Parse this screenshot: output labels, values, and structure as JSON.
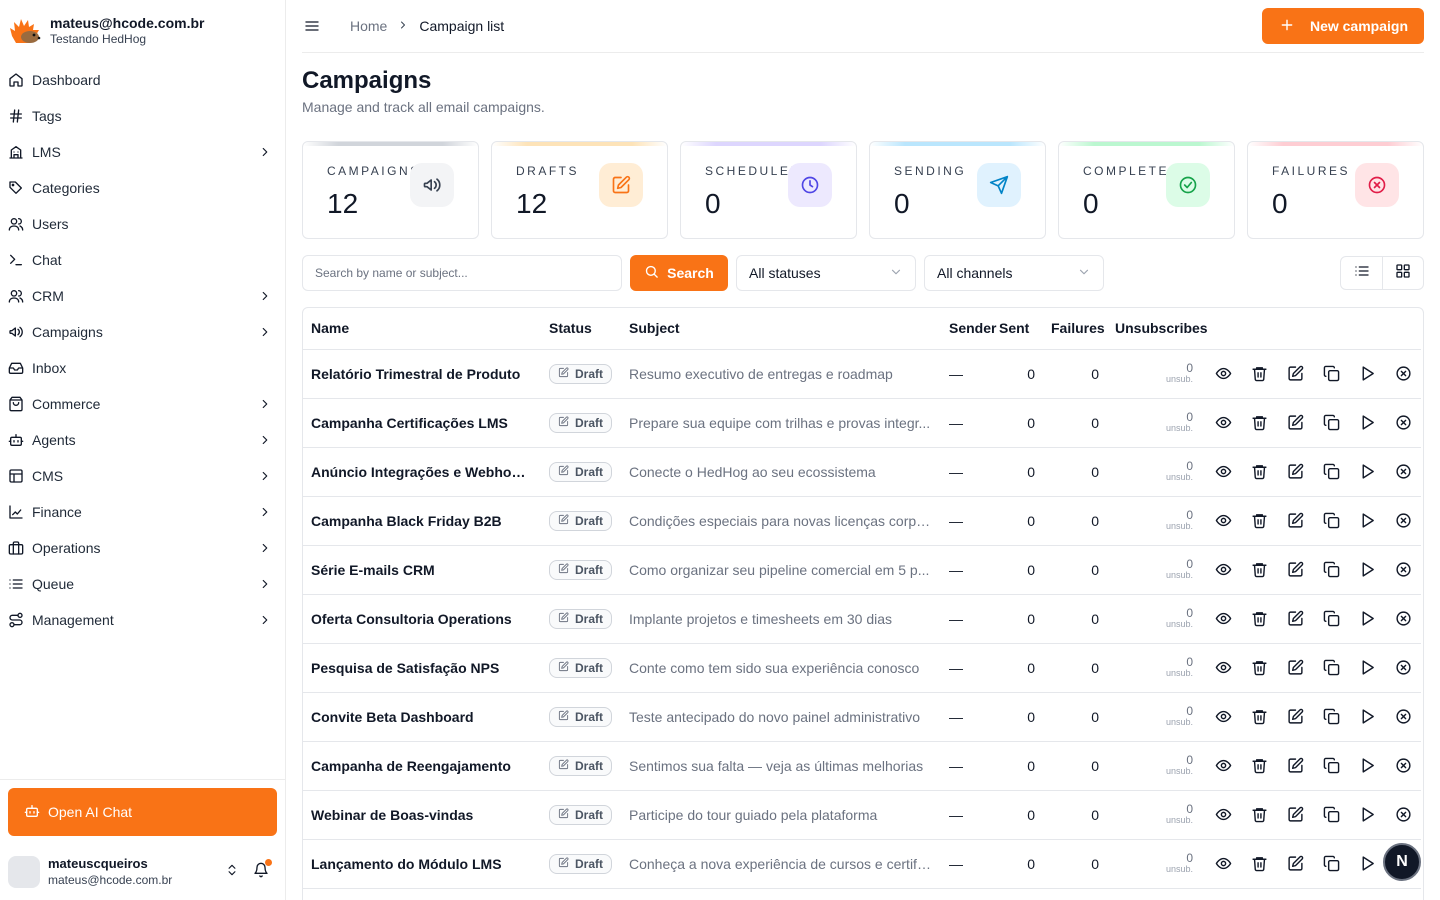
{
  "brand": {
    "email": "mateus@hcode.com.br",
    "org": "Testando HedHog"
  },
  "nav": [
    {
      "label": "Dashboard",
      "icon": "home-icon",
      "chevron": false
    },
    {
      "label": "Tags",
      "icon": "hash-icon",
      "chevron": false
    },
    {
      "label": "LMS",
      "icon": "school-icon",
      "chevron": true
    },
    {
      "label": "Categories",
      "icon": "tag-icon",
      "chevron": false
    },
    {
      "label": "Users",
      "icon": "users-icon",
      "chevron": false
    },
    {
      "label": "Chat",
      "icon": "terminal-icon",
      "chevron": false
    },
    {
      "label": "CRM",
      "icon": "users-icon",
      "chevron": true
    },
    {
      "label": "Campaigns",
      "icon": "megaphone-icon",
      "chevron": true
    },
    {
      "label": "Inbox",
      "icon": "inbox-icon",
      "chevron": false
    },
    {
      "label": "Commerce",
      "icon": "shopping-bag-icon",
      "chevron": true
    },
    {
      "label": "Agents",
      "icon": "bot-icon",
      "chevron": true
    },
    {
      "label": "CMS",
      "icon": "layout-icon",
      "chevron": true
    },
    {
      "label": "Finance",
      "icon": "chart-icon",
      "chevron": true
    },
    {
      "label": "Operations",
      "icon": "briefcase-icon",
      "chevron": true
    },
    {
      "label": "Queue",
      "icon": "list-icon",
      "chevron": true
    },
    {
      "label": "Management",
      "icon": "route-icon",
      "chevron": true
    }
  ],
  "ai_button": "Open AI Chat",
  "user": {
    "name": "mateuscqueiros",
    "email": "mateus@hcode.com.br"
  },
  "breadcrumb": {
    "home": "Home",
    "current": "Campaign list"
  },
  "new_campaign": "New campaign",
  "page": {
    "title": "Campaigns",
    "subtitle": "Manage and track all email campaigns."
  },
  "stats": [
    {
      "label": "CAMPAIGNS",
      "value": "12",
      "icon": "megaphone-icon",
      "color": "#374151",
      "bg": "#f3f4f6",
      "bar": "#d1d5db"
    },
    {
      "label": "DRAFTS",
      "value": "12",
      "icon": "edit-icon",
      "color": "#f97316",
      "bg": "#ffedd5",
      "bar": "#fde3b8"
    },
    {
      "label": "SCHEDULED",
      "value": "0",
      "icon": "clock-icon",
      "color": "#4f46e5",
      "bg": "#ede9fe",
      "bar": "#ddd6fe"
    },
    {
      "label": "SENDING",
      "value": "0",
      "icon": "send-icon",
      "color": "#0284c7",
      "bg": "#e0f2fe",
      "bar": "#bae6fd"
    },
    {
      "label": "COMPLETED",
      "value": "0",
      "icon": "check-circle-icon",
      "color": "#16a34a",
      "bg": "#dcfce7",
      "bar": "#bbf7d0"
    },
    {
      "label": "FAILURES",
      "value": "0",
      "icon": "x-circle-icon",
      "color": "#e11d48",
      "bg": "#ffe4e6",
      "bar": "#fecdd3"
    }
  ],
  "filters": {
    "search_placeholder": "Search by name or subject...",
    "search_button": "Search",
    "status": "All statuses",
    "channel": "All channels"
  },
  "table": {
    "headers": [
      "Name",
      "Status",
      "Subject",
      "Sender",
      "Sent",
      "Failures",
      "Unsubscribes"
    ],
    "rows": [
      {
        "name": "Relatório Trimestral de Produto",
        "status": "Draft",
        "subject": "Resumo executivo de entregas e roadmap",
        "sender": "—",
        "sent": "0",
        "failures": "0",
        "unsub": "0",
        "unsub_label": "unsub."
      },
      {
        "name": "Campanha Certificações LMS",
        "status": "Draft",
        "subject": "Prepare sua equipe com trilhas e provas integr...",
        "sender": "—",
        "sent": "0",
        "failures": "0",
        "unsub": "0",
        "unsub_label": "unsub."
      },
      {
        "name": "Anúncio Integrações e Webhooks",
        "status": "Draft",
        "subject": "Conecte o HedHog ao seu ecossistema",
        "sender": "—",
        "sent": "0",
        "failures": "0",
        "unsub": "0",
        "unsub_label": "unsub."
      },
      {
        "name": "Campanha Black Friday B2B",
        "status": "Draft",
        "subject": "Condições especiais para novas licenças corpor...",
        "sender": "—",
        "sent": "0",
        "failures": "0",
        "unsub": "0",
        "unsub_label": "unsub."
      },
      {
        "name": "Série E-mails CRM",
        "status": "Draft",
        "subject": "Como organizar seu pipeline comercial em 5 p...",
        "sender": "—",
        "sent": "0",
        "failures": "0",
        "unsub": "0",
        "unsub_label": "unsub."
      },
      {
        "name": "Oferta Consultoria Operations",
        "status": "Draft",
        "subject": "Implante projetos e timesheets em 30 dias",
        "sender": "—",
        "sent": "0",
        "failures": "0",
        "unsub": "0",
        "unsub_label": "unsub."
      },
      {
        "name": "Pesquisa de Satisfação NPS",
        "status": "Draft",
        "subject": "Conte como tem sido sua experiência conosco",
        "sender": "—",
        "sent": "0",
        "failures": "0",
        "unsub": "0",
        "unsub_label": "unsub."
      },
      {
        "name": "Convite Beta Dashboard",
        "status": "Draft",
        "subject": "Teste antecipado do novo painel administrativo",
        "sender": "—",
        "sent": "0",
        "failures": "0",
        "unsub": "0",
        "unsub_label": "unsub."
      },
      {
        "name": "Campanha de Reengajamento",
        "status": "Draft",
        "subject": "Sentimos sua falta — veja as últimas melhorias",
        "sender": "—",
        "sent": "0",
        "failures": "0",
        "unsub": "0",
        "unsub_label": "unsub."
      },
      {
        "name": "Webinar de Boas-vindas",
        "status": "Draft",
        "subject": "Participe do tour guiado pela plataforma",
        "sender": "—",
        "sent": "0",
        "failures": "0",
        "unsub": "0",
        "unsub_label": "unsub."
      },
      {
        "name": "Lançamento do Módulo LMS",
        "status": "Draft",
        "subject": "Conheça a nova experiência de cursos e certific...",
        "sender": "—",
        "sent": "0",
        "failures": "0",
        "unsub": "0",
        "unsub_label": "unsub."
      },
      {
        "name": "",
        "status": "",
        "subject": "",
        "sender": "",
        "sent": "",
        "failures": "",
        "unsub": "",
        "unsub_label": ""
      }
    ],
    "row_actions": [
      "eye-icon",
      "trash-icon",
      "edit-icon",
      "copy-icon",
      "play-icon",
      "x-circle-icon"
    ]
  },
  "fab_label": "N"
}
